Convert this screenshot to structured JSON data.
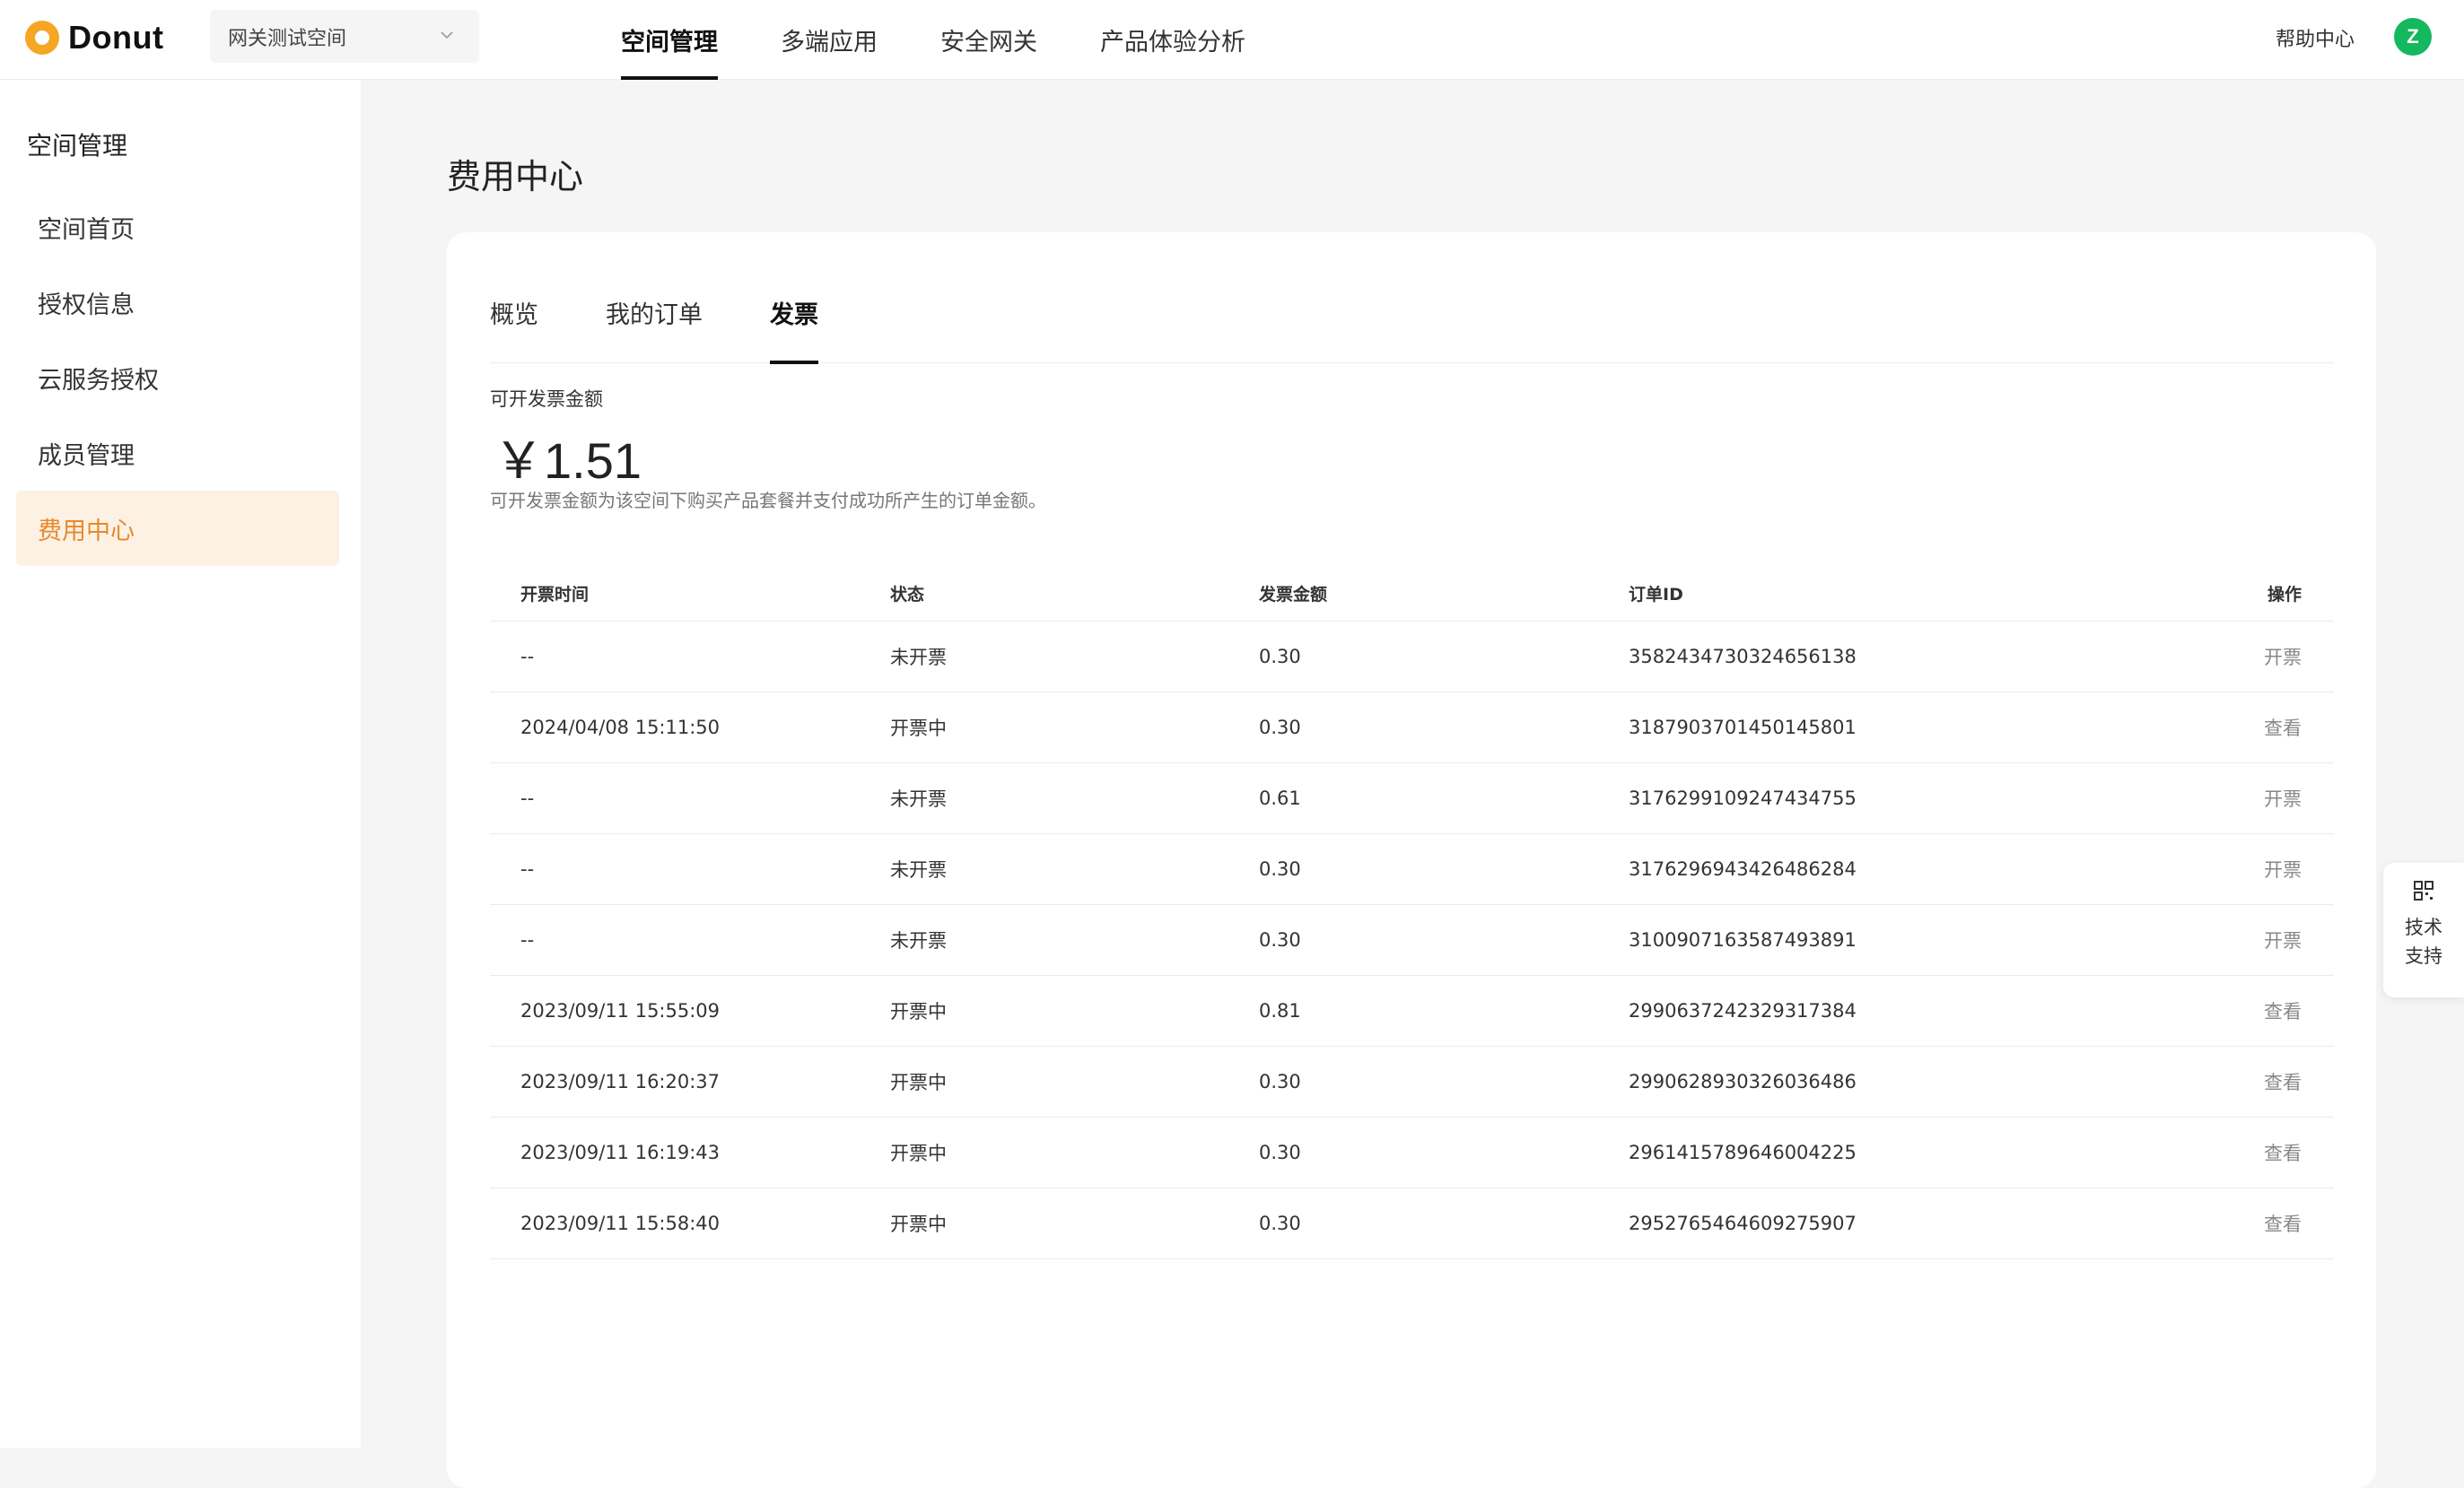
{
  "header": {
    "logo_text": "Donut",
    "space_selector": "网关测试空间",
    "nav": [
      "空间管理",
      "多端应用",
      "安全网关",
      "产品体验分析"
    ],
    "active_nav": 0,
    "help": "帮助中心",
    "avatar_letter": "Z"
  },
  "sidebar": {
    "title": "空间管理",
    "items": [
      {
        "label": "空间首页"
      },
      {
        "label": "授权信息"
      },
      {
        "label": "云服务授权"
      },
      {
        "label": "成员管理"
      },
      {
        "label": "费用中心"
      }
    ],
    "active_index": 4
  },
  "main": {
    "title": "费用中心",
    "tabs": [
      "概览",
      "我的订单",
      "发票"
    ],
    "active_tab": 2,
    "amount_label": "可开发票金额",
    "amount_value": "￥1.51",
    "amount_desc": "可开发票金额为该空间下购买产品套餐并支付成功所产生的订单金额。",
    "table": {
      "columns": [
        "开票时间",
        "状态",
        "发票金额",
        "订单ID",
        "操作"
      ],
      "rows": [
        {
          "time": "--",
          "status": "未开票",
          "amount": "0.30",
          "order_id": "3582434730324656138",
          "action": "开票"
        },
        {
          "time": "2024/04/08 15:11:50",
          "status": "开票中",
          "amount": "0.30",
          "order_id": "3187903701450145801",
          "action": "查看"
        },
        {
          "time": "--",
          "status": "未开票",
          "amount": "0.61",
          "order_id": "3176299109247434755",
          "action": "开票"
        },
        {
          "time": "--",
          "status": "未开票",
          "amount": "0.30",
          "order_id": "3176296943426486284",
          "action": "开票"
        },
        {
          "time": "--",
          "status": "未开票",
          "amount": "0.30",
          "order_id": "3100907163587493891",
          "action": "开票"
        },
        {
          "time": "2023/09/11 15:55:09",
          "status": "开票中",
          "amount": "0.81",
          "order_id": "2990637242329317384",
          "action": "查看"
        },
        {
          "time": "2023/09/11 16:20:37",
          "status": "开票中",
          "amount": "0.30",
          "order_id": "2990628930326036486",
          "action": "查看"
        },
        {
          "time": "2023/09/11 16:19:43",
          "status": "开票中",
          "amount": "0.30",
          "order_id": "2961415789646004225",
          "action": "查看"
        },
        {
          "time": "2023/09/11 15:58:40",
          "status": "开票中",
          "amount": "0.30",
          "order_id": "2952765464609275907",
          "action": "查看"
        }
      ]
    }
  },
  "support": {
    "label": "技术支持",
    "icon": "qr-code-icon"
  },
  "colors": {
    "accent": "#e8892b",
    "accent_bg": "#fdf1e4",
    "logo": "#f5a623",
    "avatar": "#14b85e"
  }
}
